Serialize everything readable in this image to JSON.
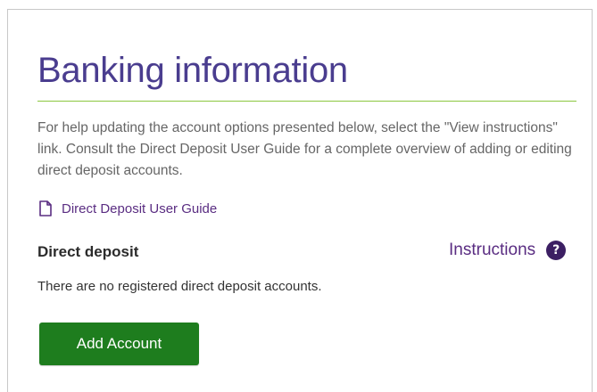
{
  "header": {
    "title": "Banking information"
  },
  "intro": {
    "text": "For help updating the account options presented below, select the \"View instructions\" link. Consult the Direct Deposit User Guide for a complete overview of adding or editing direct deposit accounts."
  },
  "guide_link": {
    "icon": "document-icon",
    "label": "Direct Deposit User Guide"
  },
  "direct_deposit": {
    "title": "Direct deposit",
    "instructions_label": "Instructions",
    "help_icon": "question-mark-icon",
    "help_symbol": "?",
    "empty_message": "There are no registered direct deposit accounts.",
    "add_button_label": "Add Account"
  },
  "colors": {
    "title": "#4a3d8f",
    "rule": "#8cc63f",
    "link": "#5a2d82",
    "help_icon_bg": "#3c1f63",
    "button_bg": "#1e7d1e"
  }
}
